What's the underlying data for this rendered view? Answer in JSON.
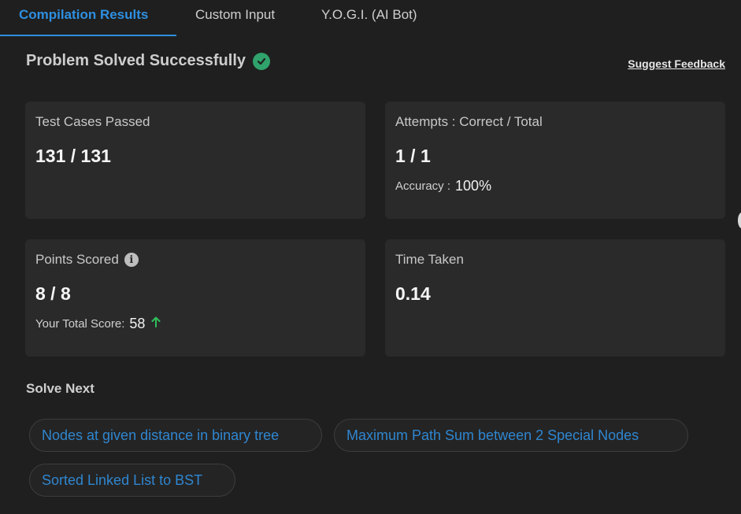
{
  "tabs": [
    {
      "label": "Compilation Results",
      "active": true
    },
    {
      "label": "Custom Input",
      "active": false
    },
    {
      "label": "Y.O.G.I. (AI Bot)",
      "active": false
    }
  ],
  "status": {
    "title": "Problem Solved Successfully",
    "icon": "check-circle-icon",
    "feedback_link": "Suggest Feedback"
  },
  "cards": {
    "test_cases": {
      "label": "Test Cases Passed",
      "value": "131 / 131"
    },
    "attempts": {
      "label": "Attempts : Correct / Total",
      "value": "1 / 1",
      "sub_label": "Accuracy :",
      "sub_value": "100%"
    },
    "points": {
      "label": "Points Scored",
      "value": "8 / 8",
      "sub_label": "Your Total Score:",
      "sub_value": "58",
      "info_icon": "info-icon",
      "trend_icon": "arrow-up-icon"
    },
    "time": {
      "label": "Time Taken",
      "value": "0.14"
    }
  },
  "solve_next": {
    "heading": "Solve Next",
    "items": [
      "Nodes at given distance in binary tree",
      "Maximum Path Sum between 2 Special Nodes",
      "Sorted Linked List to BST"
    ]
  },
  "colors": {
    "accent": "#2e8fe0",
    "success": "#2fa36b",
    "background": "#1f1f1f",
    "card": "#2a2a2a"
  }
}
